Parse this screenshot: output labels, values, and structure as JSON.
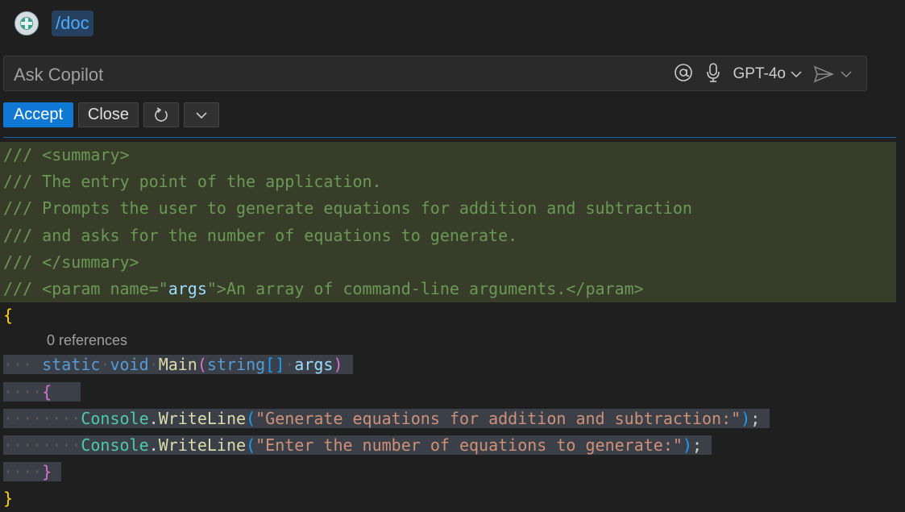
{
  "chat": {
    "slash_command": "/doc",
    "input_placeholder": "Ask Copilot",
    "model_label": "GPT-4o"
  },
  "actions": {
    "accept_label": "Accept",
    "close_label": "Close"
  },
  "code": {
    "doc_comments": [
      "/// <summary>",
      "/// The entry point of the application.",
      "/// Prompts the user to generate equations for addition and subtraction",
      "/// and asks for the number of equations to generate.",
      "/// </summary>"
    ],
    "param_prefix": "/// <param name=\"",
    "param_name": "args",
    "param_suffix": "\">An array of command-line arguments.</param>",
    "open_brace": "{",
    "close_brace": "}",
    "codelens": "0 references",
    "kw_static": "static",
    "kw_void": "void",
    "method_name": "Main",
    "param_type": "string",
    "param_var": "args",
    "console": "Console",
    "writeline": "WriteLine",
    "str1": "\"Generate equations for addition and subtraction:\"",
    "str2": "\"Enter the number of equations to generate:\""
  },
  "colors": {
    "accent": "#0e78d4",
    "doc_comment_bg": "#373d29",
    "comment": "#6a9955"
  }
}
